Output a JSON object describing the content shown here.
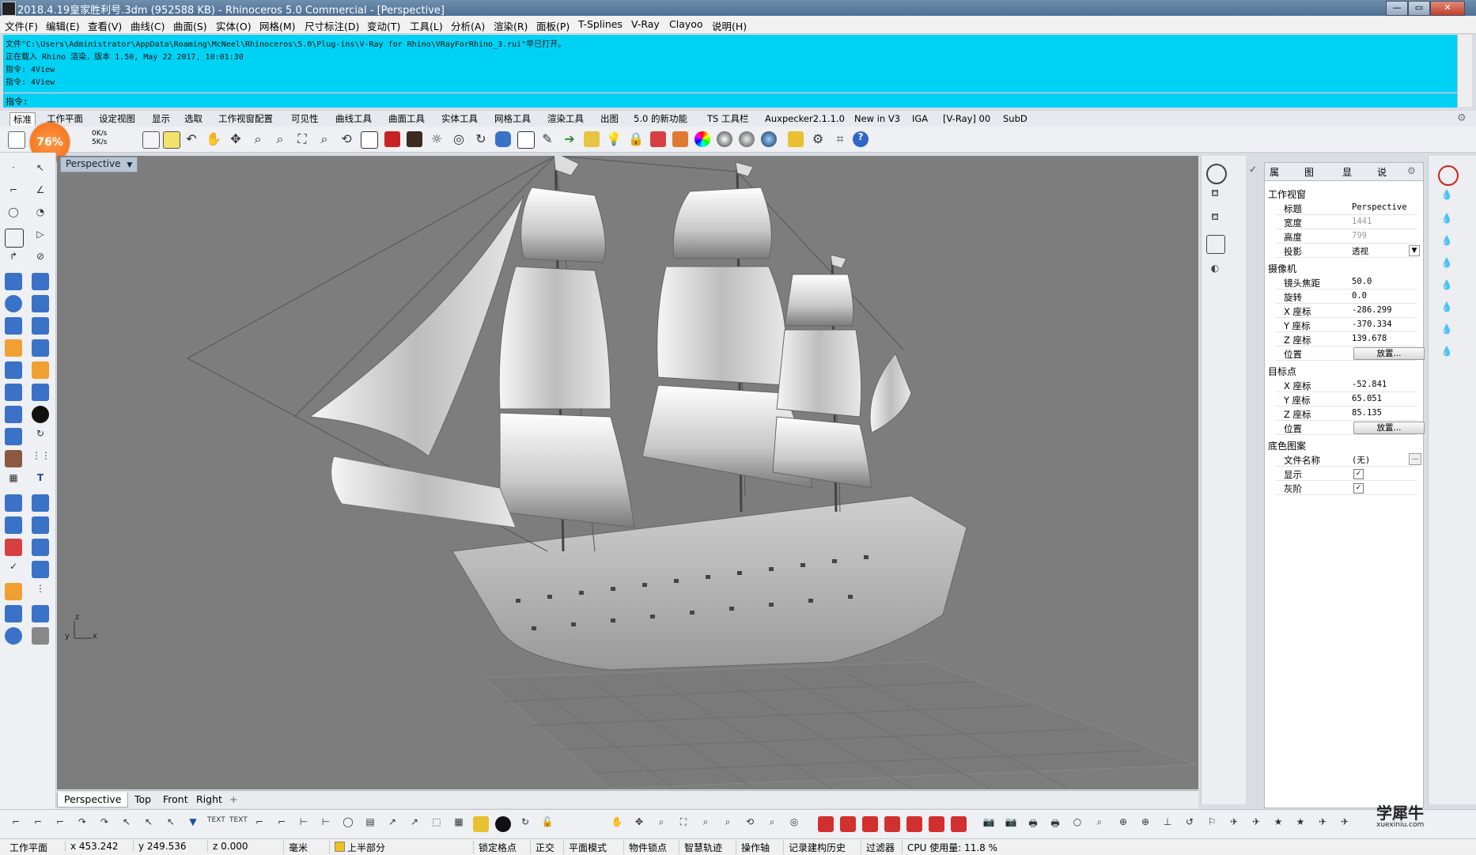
{
  "window": {
    "title": "2018.4.19皇家胜利号.3dm (952588 KB) - Rhinoceros 5.0 Commercial - [Perspective]",
    "buttons": {
      "minimize": "—",
      "restore": "▭",
      "close": "✕"
    }
  },
  "menu": [
    "文件(F)",
    "编辑(E)",
    "查看(V)",
    "曲线(C)",
    "曲面(S)",
    "实体(O)",
    "网格(M)",
    "尺寸标注(D)",
    "变动(T)",
    "工具(L)",
    "分析(A)",
    "渲染(R)",
    "面板(P)",
    "T-Splines",
    "V-Ray",
    "Clayoo",
    "说明(H)"
  ],
  "command": {
    "history": [
      "文件\"C:\\Users\\Administrator\\AppData\\Roaming\\McNeel\\Rhinoceros\\5.0\\Plug-ins\\V-Ray for Rhino\\VRayForRhino_3.rui\"早已打开。",
      "正在载入 Rhino 渲染，版本 1.50, May 22 2017, 10:01:30",
      "指令: 4View",
      "指令: 4View"
    ],
    "prompt": "指令:"
  },
  "toolbar_tabs": [
    "标准",
    "工作平面",
    "设定视图",
    "显示",
    "选取",
    "工作视窗配置",
    "可见性",
    "曲线工具",
    "曲面工具",
    "实体工具",
    "网格工具",
    "渲染工具",
    "出图",
    "5.0 的新功能",
    "TS 工具栏",
    "Auxpecker2.1.1.0",
    "New in V3",
    "IGA",
    "[V-Ray] 00",
    "SubD"
  ],
  "toolbar_active_tab": "标准",
  "perf_badge": {
    "percent": "76%",
    "up": "0K/s",
    "down": "5K/s"
  },
  "viewport": {
    "name": "Perspective",
    "axis": {
      "z": "z",
      "y": "y",
      "x": "x"
    },
    "tabs": [
      "Perspective",
      "Top",
      "Front",
      "Right"
    ],
    "add_tab": "+"
  },
  "properties": {
    "tabs": [
      "属",
      "图",
      "显",
      "说"
    ],
    "sections": {
      "viewport": {
        "header": "工作视窗",
        "rows": [
          {
            "label": "标题",
            "value": "Perspective"
          },
          {
            "label": "宽度",
            "value": "1441"
          },
          {
            "label": "高度",
            "value": "799"
          },
          {
            "label": "投影",
            "value": "透视"
          }
        ]
      },
      "camera": {
        "header": "摄像机",
        "rows": [
          {
            "label": "镜头焦距",
            "value": "50.0"
          },
          {
            "label": "旋转",
            "value": "0.0"
          },
          {
            "label": "X 座标",
            "value": "-286.299"
          },
          {
            "label": "Y 座标",
            "value": "-370.334"
          },
          {
            "label": "Z 座标",
            "value": "139.678"
          },
          {
            "label": "位置",
            "button": "放置..."
          }
        ]
      },
      "target": {
        "header": "目标点",
        "rows": [
          {
            "label": "X 座标",
            "value": "-52.841"
          },
          {
            "label": "Y 座标",
            "value": "65.051"
          },
          {
            "label": "Z 座标",
            "value": "85.135"
          },
          {
            "label": "位置",
            "button": "放置..."
          }
        ]
      },
      "wallpaper": {
        "header": "底色图案",
        "rows": [
          {
            "label": "文件名称",
            "value": "(无)",
            "button": "..."
          },
          {
            "label": "显示",
            "checked": "✓"
          },
          {
            "label": "灰阶",
            "checked": "✓"
          }
        ]
      }
    }
  },
  "status": {
    "cplane": "工作平面",
    "x": "x 453.242",
    "y": "y 249.536",
    "z": "z 0.000",
    "units": "毫米",
    "layer": "上半部分",
    "toggles": [
      "锁定格点",
      "正交",
      "平面模式",
      "物件锁点",
      "智慧轨迹",
      "操作轴",
      "记录建构历史",
      "过滤器"
    ],
    "cpu": "CPU 使用量: 11.8 %"
  },
  "watermark": {
    "text": "学犀牛",
    "sub": "xuexiniu.com"
  },
  "colors": {
    "cmd_bg": "#00d2f5",
    "viewport_bg": "#7d7d7d",
    "badge": "#f26a10"
  },
  "chart_data": {
    "type": "table",
    "title": "",
    "rows": [
      [
        "标题",
        "Perspective"
      ],
      [
        "宽度",
        "1441"
      ],
      [
        "高度",
        "799"
      ],
      [
        "投影",
        "透视"
      ],
      [
        "镜头焦距",
        "50.0"
      ],
      [
        "旋转",
        "0.0"
      ],
      [
        "X 座标",
        "-286.299"
      ],
      [
        "Y 座标",
        "-370.334"
      ],
      [
        "Z 座标",
        "139.678"
      ],
      [
        "X 座标",
        "-52.841"
      ],
      [
        "Y 座标",
        "65.051"
      ],
      [
        "Z 座标",
        "85.135"
      ]
    ]
  }
}
